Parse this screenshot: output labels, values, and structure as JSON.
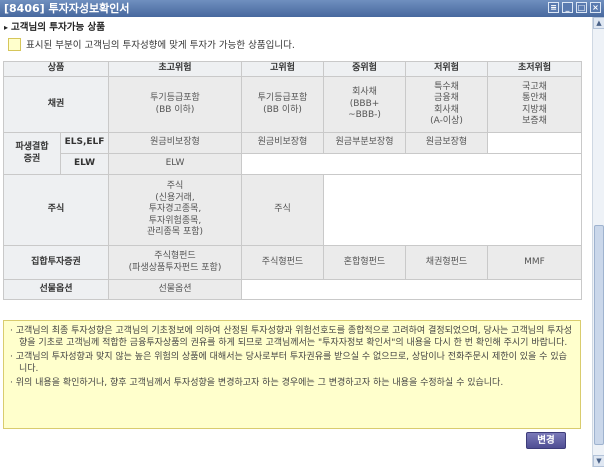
{
  "window": {
    "title": "[8406] 투자자성보확인서",
    "controls": [
      "≡",
      "_",
      "□",
      "×"
    ]
  },
  "section_title": "고객님의 투자가능 상품",
  "legend_text": "표시된 부분이 고객님의 투자성향에 맞게 투자가 가능한 상품입니다.",
  "table": {
    "headers": [
      "상품",
      "초고위험",
      "고위험",
      "중위험",
      "저위험",
      "초저위험"
    ],
    "bond": {
      "label": "채권",
      "very_high": "투기등급포함\n(BB 이하)",
      "high": "투기등급포함\n(BB 이하)",
      "mid": "회사채\n(BBB+\n~BBB-)",
      "low": "특수채\n금융채\n회사채\n(A-이상)",
      "very_low": "국고채\n통안채\n지방채\n보증채"
    },
    "derivative": {
      "label": "파생결합\n증권",
      "els_label": "ELS,ELF",
      "els_very_high": "원금비보장형",
      "els_high": "원금비보장형",
      "els_mid": "원금부분보장형",
      "els_low": "원금보장형",
      "elw_label": "ELW",
      "elw_very_high": "ELW"
    },
    "stock": {
      "label": "주식",
      "very_high": "주식\n(신용거래,\n투자경고종목,\n투자위험종목,\n관리종목 포함)",
      "high": "주식"
    },
    "fund": {
      "label": "집합투자증권",
      "very_high": "주식형펀드\n(파생상품투자펀드 포함)",
      "high": "주식형펀드",
      "mid": "혼합형펀드",
      "low": "채권형펀드",
      "very_low": "MMF"
    },
    "futures": {
      "label": "선물옵션",
      "very_high": "선물옵션"
    }
  },
  "notice": [
    "· 고객님의 최종 투자성향은 고객님의 기초정보에 의하여 산정된 투자성향과 위험선호도를 종합적으로 고려하여 결정되었으며, 당사는 고객님의 투자성향을 기초로 고객님께 적합한 금융투자상품의 권유를 하게 되므로 고객님께서는 \"투자자정보 확인서\"의 내용을 다시 한 번 확인해 주시기 바랍니다.",
    "· 고객님의 투자성향과 맞지 않는 높은 위험의 상품에 대해서는 당사로부터 투자권유를 받으실 수 없으므로, 상담이나 전화주문시 제한이 있을 수 있습니다.",
    "· 위의 내용을 확인하거나, 향후 고객님께서 투자성향을 변경하고자 하는 경우에는 그 변경하고자 하는 내용을 수정하실 수 있습니다."
  ],
  "change_button": "변경"
}
